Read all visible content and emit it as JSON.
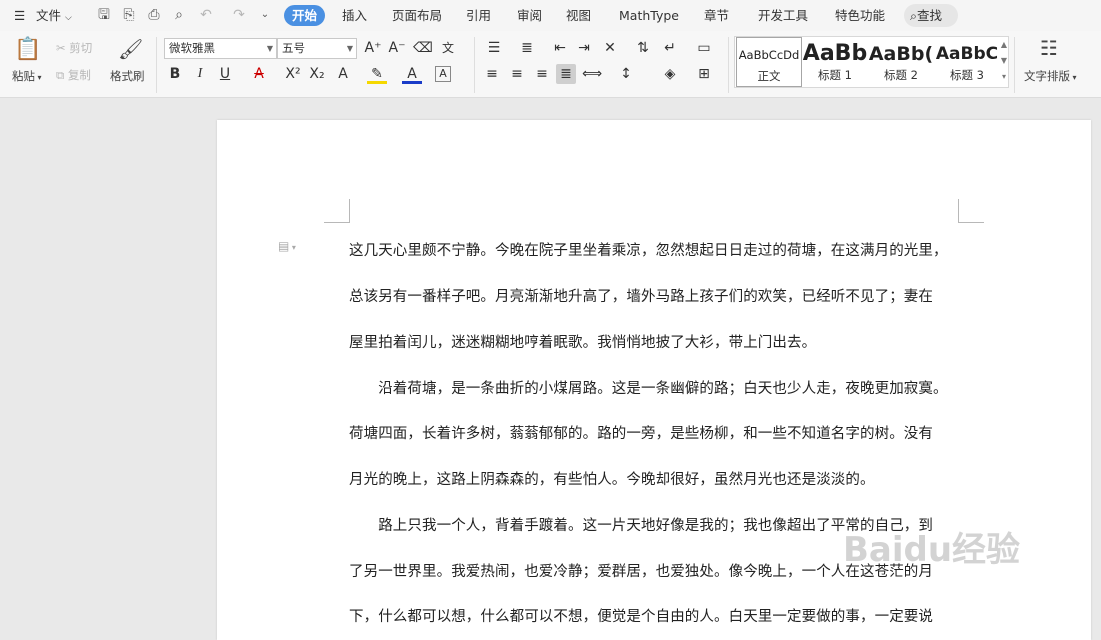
{
  "menubar": {
    "file_label": "文件",
    "tabs": [
      {
        "label": "开始",
        "active": true
      },
      {
        "label": "插入"
      },
      {
        "label": "页面布局"
      },
      {
        "label": "引用"
      },
      {
        "label": "审阅"
      },
      {
        "label": "视图"
      },
      {
        "label": "MathType"
      },
      {
        "label": "章节"
      },
      {
        "label": "开发工具"
      },
      {
        "label": "特色功能"
      }
    ],
    "search_label": "查找"
  },
  "ribbon": {
    "paste_label": "粘贴",
    "cut_label": "剪切",
    "copy_label": "复制",
    "format_painter_label": "格式刷",
    "font_name": "微软雅黑",
    "font_size": "五号",
    "styles": [
      {
        "preview": "AaBbCcDd",
        "name": "正文"
      },
      {
        "preview": "AaBb",
        "name": "标题 1"
      },
      {
        "preview": "AaBb(",
        "name": "标题 2"
      },
      {
        "preview": "AaBbC",
        "name": "标题 3"
      }
    ],
    "text_layout_label": "文字排版"
  },
  "document": {
    "lines": [
      "这几天心里颇不宁静。今晚在院子里坐着乘凉，忽然想起日日走过的荷塘，在这满月的光里，",
      "总该另有一番样子吧。月亮渐渐地升高了，墙外马路上孩子们的欢笑，已经听不见了；妻在",
      "屋里拍着闰儿，迷迷糊糊地哼着眠歌。我悄悄地披了大衫，带上门出去。",
      "　　沿着荷塘，是一条曲折的小煤屑路。这是一条幽僻的路；白天也少人走，夜晚更加寂寞。",
      "荷塘四面，长着许多树，蓊蓊郁郁的。路的一旁，是些杨柳，和一些不知道名字的树。没有",
      "月光的晚上，这路上阴森森的，有些怕人。今晚却很好，虽然月光也还是淡淡的。",
      "　　路上只我一个人，背着手踱着。这一片天地好像是我的；我也像超出了平常的自己，到",
      "了另一世界里。我爱热闹，也爱冷静；爱群居，也爱独处。像今晚上，一个人在这苍茫的月",
      "下，什么都可以想，什么都可以不想，便觉是个自由的人。白天里一定要做的事，一定要说"
    ]
  },
  "watermark": "Baidu经验"
}
